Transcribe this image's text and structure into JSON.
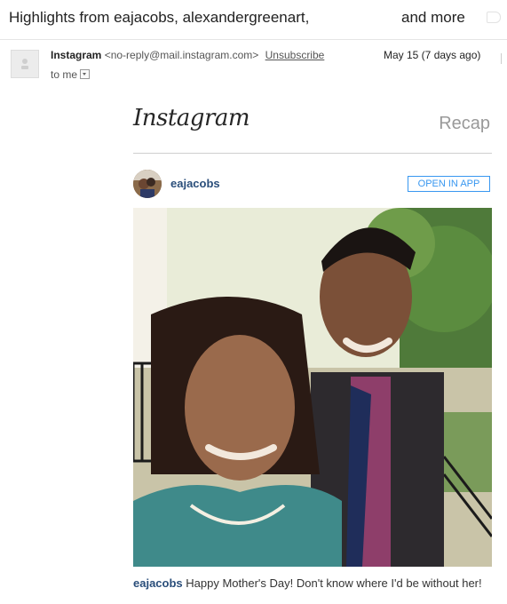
{
  "email": {
    "subject": "Highlights from eajacobs, alexandergreenart,",
    "subject_more": "and more",
    "sender_name": "Instagram",
    "sender_address": "<no-reply@mail.instagram.com>",
    "unsubscribe_label": "Unsubscribe",
    "recipient": "to me",
    "date": "May 15 (7 days ago)"
  },
  "body": {
    "logo_text": "Instagram",
    "header_title": "Recap",
    "post": {
      "username": "eajacobs",
      "open_button": "OPEN IN APP",
      "photo_icon": "photo-selfie",
      "caption_user": "eajacobs",
      "caption_text": "Happy Mother's Day! Don't know where I'd be without her!"
    }
  },
  "colors": {
    "link_blue": "#3897f0",
    "username_blue": "#2a4e7a",
    "muted_gray": "#999999"
  }
}
